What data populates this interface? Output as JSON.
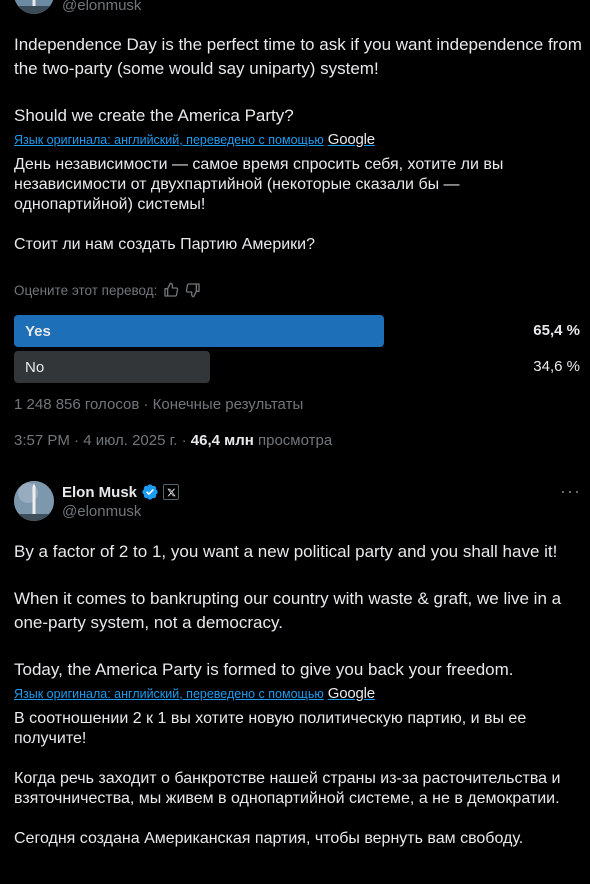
{
  "post1": {
    "handle": "@elonmusk",
    "original_text": "Independence Day is the perfect time to ask if you want independence from the two-party (some would say uniparty) system!\n\nShould we create the America Party?",
    "translation_note": "Язык оригинала: английский, переведено с помощью",
    "google_label": "Google",
    "translated_text": "День независимости — самое время спросить себя, хотите ли вы независимости от двухпартийной (некоторые сказали бы — однопартийной) системы!\n\nСтоит ли нам создать Партию Америки?",
    "rate_label": "Оцените этот перевод:",
    "poll": {
      "options": [
        {
          "label": "Yes",
          "percent_text": "65,4 %",
          "percent": 65.4,
          "color": "#1d6fb8",
          "winner": true
        },
        {
          "label": "No",
          "percent_text": "34,6 %",
          "percent": 34.6,
          "color": "#333639",
          "winner": false
        }
      ],
      "summary": "1 248 856 голосов · Конечные результаты"
    },
    "time": "3:57 PM · 4 июл. 2025 г. · ",
    "views_count": "46,4 млн",
    "views_label": " просмотра"
  },
  "post2": {
    "name": "Elon Musk",
    "handle": "@elonmusk",
    "more": "···",
    "original_text": "By a factor of 2 to 1, you want a new political party and you shall have it!\n\nWhen it comes to bankrupting our country with waste & graft, we live in a one-party system, not a democracy.\n\nToday, the America Party is formed to give you back your freedom.",
    "translation_note": "Язык оригинала: английский, переведено с помощью",
    "google_label": "Google",
    "translated_text": "В соотношении 2 к 1 вы хотите новую политическую партию, и вы ее получите!\n\nКогда речь заходит о банкротстве нашей страны из-за расточительства и взяточничества, мы живем в однопартийной системе, а не в демократии.\n\nСегодня создана Американская партия, чтобы вернуть вам свободу."
  },
  "colors": {
    "background": "#000000",
    "text": "#e7e9ea",
    "muted": "#71767b",
    "link": "#1d9bf0",
    "verified": "#1d9bf0"
  },
  "icons": [
    "avatar",
    "thumbs-up-icon",
    "thumbs-down-icon",
    "verified-icon",
    "x-affiliate-icon",
    "more-icon"
  ]
}
